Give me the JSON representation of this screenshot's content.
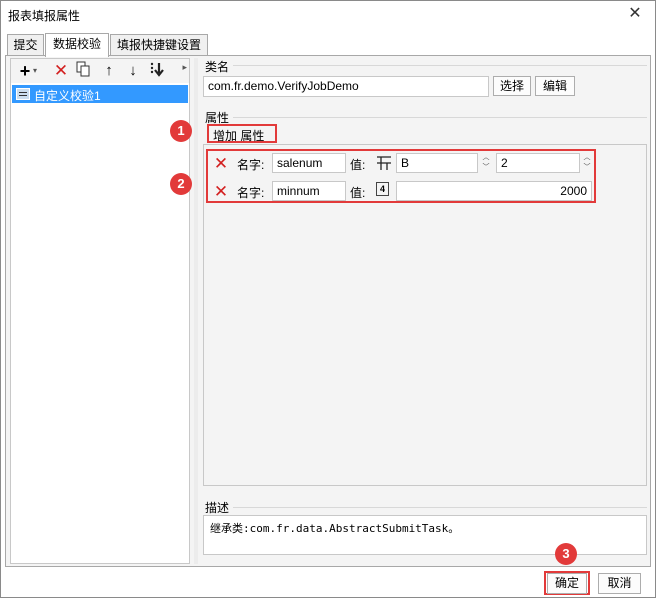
{
  "window": {
    "title": "报表填报属性",
    "close_glyph": "✕"
  },
  "tabs": [
    {
      "label": "提交"
    },
    {
      "label": "数据校验"
    },
    {
      "label": "填报快捷键设置"
    }
  ],
  "toolbar": {
    "add_icon": "plus-icon",
    "delete_icon": "delete-icon",
    "copy_icon": "copy-icon",
    "up_icon": "arrow-up-icon",
    "down_icon": "arrow-down-icon",
    "bottom_icon": "move-bottom-icon"
  },
  "validation_list": [
    {
      "label": "自定义校验1"
    }
  ],
  "class_section": {
    "label": "类名",
    "value": "com.fr.demo.VerifyJobDemo",
    "select_label": "选择",
    "edit_label": "编辑"
  },
  "props_section": {
    "label": "属性",
    "add_label": "增加 属性",
    "name_label": "名字:",
    "value_label": "值:",
    "rows": [
      {
        "name": "salenum",
        "type": "cell",
        "value_a": "B",
        "value_b": "2"
      },
      {
        "name": "minnum",
        "type": "number",
        "type_glyph": "4",
        "value": "2000"
      }
    ]
  },
  "desc_section": {
    "label": "描述",
    "text": "继承类:com.fr.data.AbstractSubmitTask。"
  },
  "annotations": [
    "1",
    "2",
    "3"
  ],
  "footer": {
    "ok_label": "确定",
    "cancel_label": "取消"
  },
  "colors": {
    "highlight": "#e23a3a",
    "selection": "#3399ff",
    "delete": "#d32020"
  }
}
